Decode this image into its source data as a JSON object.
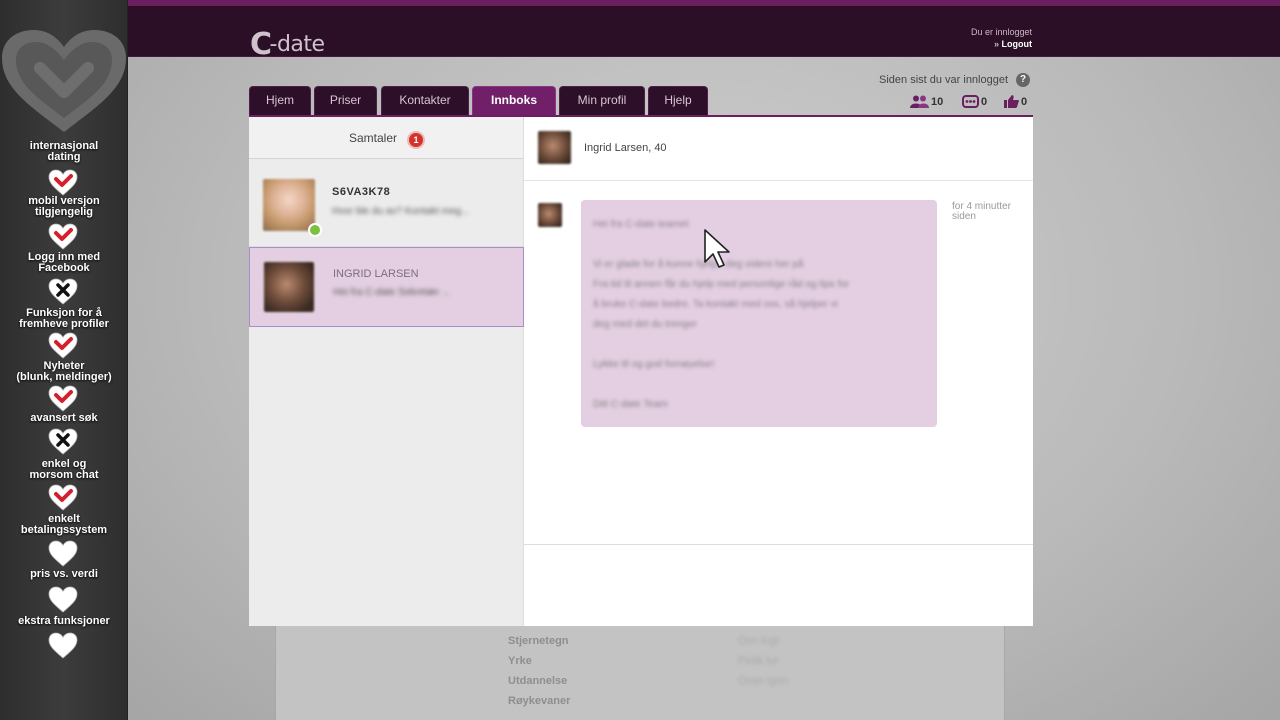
{
  "brand": {
    "logo_mark": "C",
    "logo_text": "-date"
  },
  "header": {
    "logged_in": "Du er innlogget",
    "logout": "Logout"
  },
  "sidebar": {
    "features": [
      {
        "label_lines": [
          "internasjonal",
          "dating"
        ],
        "status": "check"
      },
      {
        "label_lines": [
          "mobil versjon",
          "tilgjengelig"
        ],
        "status": "check"
      },
      {
        "label_lines": [
          "Logg inn med",
          "Facebook"
        ],
        "status": "cross"
      },
      {
        "label_lines": [
          "Funksjon for å",
          "fremheve profiler"
        ],
        "status": "check"
      },
      {
        "label_lines": [
          "Nyheter",
          "(blunk, meldinger)"
        ],
        "status": "check"
      },
      {
        "label_lines": [
          "avansert søk"
        ],
        "status": "cross"
      },
      {
        "label_lines": [
          "enkel og",
          "morsom chat"
        ],
        "status": "check"
      },
      {
        "label_lines": [
          "enkelt",
          "betalingssystem"
        ],
        "status": "empty"
      },
      {
        "label_lines": [
          "pris vs. verdi"
        ],
        "status": "empty"
      },
      {
        "label_lines": [
          "ekstra funksjoner"
        ],
        "status": "empty"
      }
    ]
  },
  "tabs": [
    "Hjem",
    "Priser",
    "Kontakter",
    "Innboks",
    "Min profil",
    "Hjelp"
  ],
  "active_tab": "Innboks",
  "since_last": "Siden sist du var innlogget",
  "stats": {
    "visitors": "10",
    "messages": "0",
    "likes": "0"
  },
  "conversations": {
    "title": "Samtaler",
    "badge": "1",
    "items": [
      {
        "name": "S6VA3K78",
        "snippet": "Hvor ble du av? Kontakt meg..."
      },
      {
        "name": "INGRID LARSEN",
        "snippet": "Hei fra C-date Sekretær ..."
      }
    ]
  },
  "chat": {
    "contact": "Ingrid Larsen, 40",
    "time": "for 4 minutter siden",
    "message_lines": [
      "Hei fra C-date teamet",
      "",
      "Vi er glade for å kunne hjelpe deg videre her på",
      "Fra tid til annen får du hjelp med personlige råd og tips for",
      "å bruke C-date bedre. Ta kontakt med oss, så hjelper vi",
      "deg med det du trenger",
      "",
      "Lykke til og god fornøyelse!",
      "",
      "Ditt C-date Team"
    ]
  },
  "profile_fields": [
    {
      "label": "Stjernetegn",
      "value": "Ovn lugt"
    },
    {
      "label": "Yrke",
      "value": "Pedk lur"
    },
    {
      "label": "Utdannelse",
      "value": "Ovan lgnn"
    },
    {
      "label": "Røykevaner",
      "value": ""
    }
  ],
  "colors": {
    "brand_purple": "#711f69",
    "header_dark": "#2a0f26",
    "bubble": "#e3cfe1"
  }
}
